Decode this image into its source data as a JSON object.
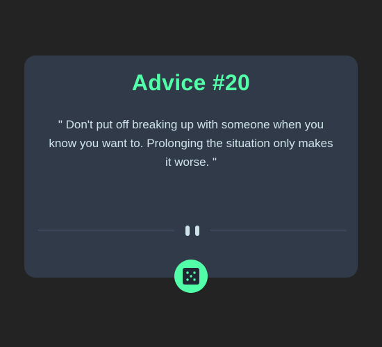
{
  "advice": {
    "title": "Advice #20",
    "quote": "\" Don't put off breaking up with someone when you know you want to. Prolonging the situation only makes it worse. \""
  },
  "icons": {
    "divider": "pause-icon",
    "button": "dice-icon"
  },
  "colors": {
    "background": "#232323",
    "card": "#313a48",
    "accent": "#52ffa8",
    "text": "#cee3e9",
    "divider": "#4f5d74"
  }
}
